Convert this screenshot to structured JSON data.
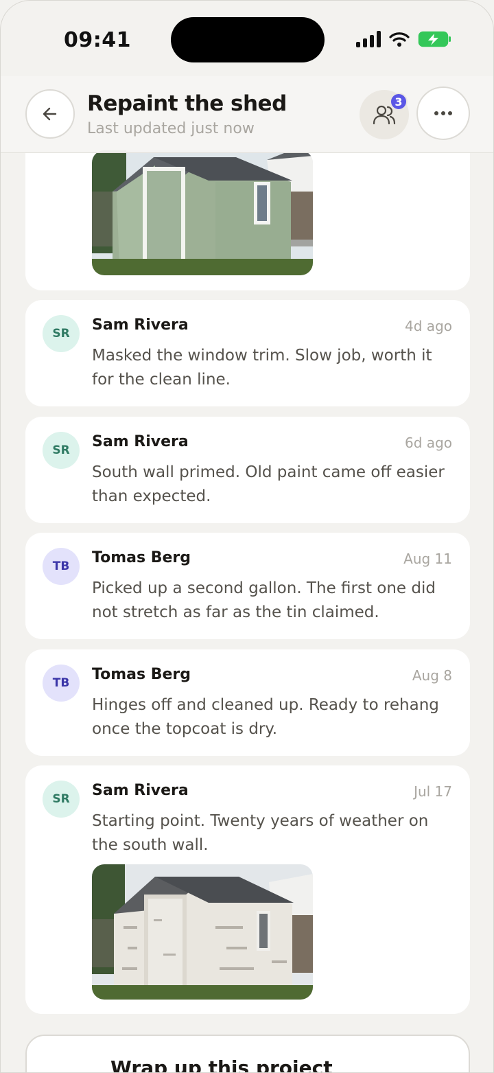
{
  "status": {
    "time": "09:41"
  },
  "header": {
    "title": "Repaint the shed",
    "subtitle": "Last updated just now",
    "members_count": "3"
  },
  "feed": [
    {
      "initials": "SR",
      "author": "Sam Rivera",
      "time": "4d ago",
      "text": "Masked the window trim. Slow job, worth it for the clean line."
    },
    {
      "initials": "SR",
      "author": "Sam Rivera",
      "time": "6d ago",
      "text": "South wall primed. Old paint came off easier than expected."
    },
    {
      "initials": "TB",
      "author": "Tomas Berg",
      "time": "Aug 11",
      "text": "Picked up a second gallon. The first one did not stretch as far as the tin claimed."
    },
    {
      "initials": "TB",
      "author": "Tomas Berg",
      "time": "Aug 8",
      "text": "Hinges off and cleaned up. Ready to rehang once the topcoat is dry."
    },
    {
      "initials": "SR",
      "author": "Sam Rivera",
      "time": "Jul 17",
      "text": "Starting point. Twenty years of weather on the south wall."
    }
  ],
  "wrap_up": {
    "title": "Wrap up this project"
  },
  "colors": {
    "accent": "#5b57e6",
    "sr_avatar": "#dcf3ec",
    "tb_avatar": "#e3e2fb"
  }
}
